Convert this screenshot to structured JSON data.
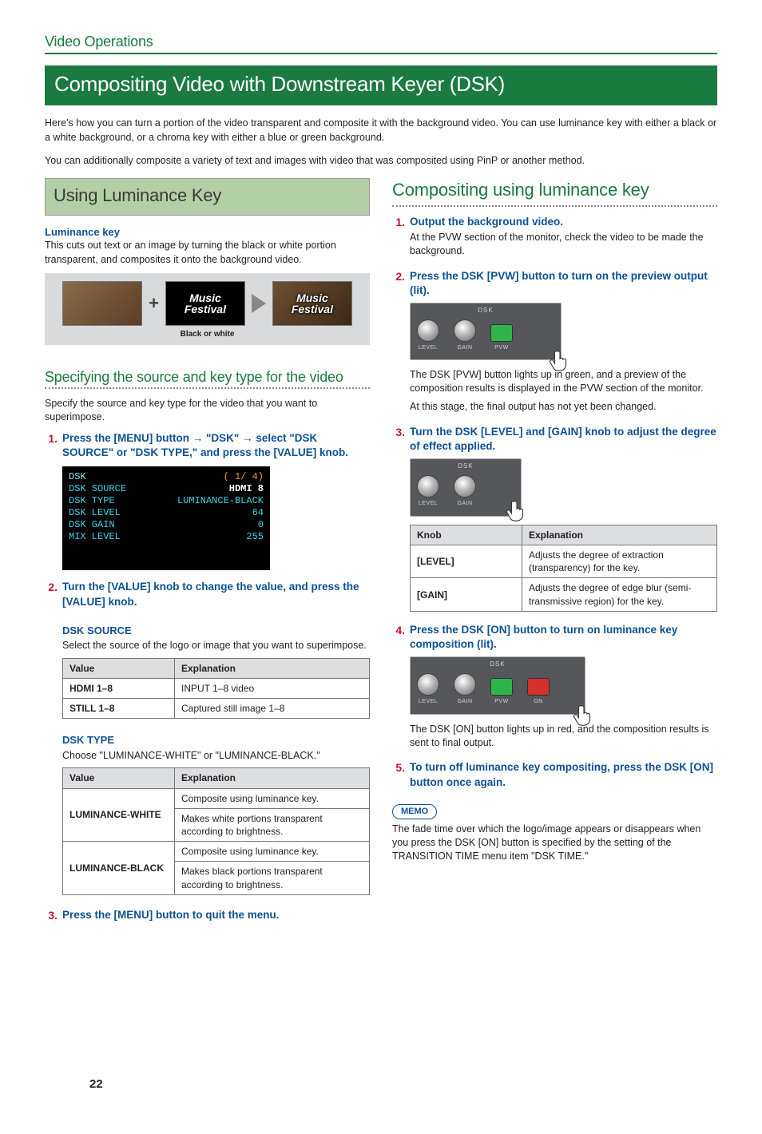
{
  "breadcrumb": "Video Operations",
  "h1": "Compositing Video with Downstream Keyer (DSK)",
  "intro1": "Here's how you can turn a portion of the video transparent and composite it with the background video. You can use luminance key with either a black or a white background, or a chroma key with either a blue or green background.",
  "intro2": "You can additionally composite a variety of text and images with video that was composited using PinP or another method.",
  "left": {
    "h2": "Using Luminance Key",
    "lk_head": "Luminance key",
    "lk_desc": "This cuts out text or an image by turning the black or white portion transparent, and composites it onto the background video.",
    "fig": {
      "mf1": "Music",
      "mf2": "Festival",
      "plus": "+",
      "cap": "Black or white"
    },
    "h3a": "Specifying the source and key type for the video",
    "h3a_desc": "Specify the source and key type for the video that you want to superimpose.",
    "step1": {
      "num": "1.",
      "title_a": "Press the [MENU] button ",
      "arrow": "→",
      "title_b": " \"DSK\" ",
      "title_c": " select \"DSK SOURCE\" or \"DSK TYPE,\" and press the [VALUE] knob."
    },
    "menu": {
      "title": "DSK",
      "page": "( 1/ 4)",
      "rows": [
        {
          "l": "DSK SOURCE",
          "r": "HDMI 8",
          "sel": true
        },
        {
          "l": "DSK TYPE",
          "r": "LUMINANCE-BLACK"
        },
        {
          "l": "DSK LEVEL",
          "r": "64"
        },
        {
          "l": "DSK GAIN",
          "r": "0"
        },
        {
          "l": "MIX LEVEL",
          "r": "255"
        }
      ]
    },
    "step2": {
      "num": "2.",
      "title": "Turn the [VALUE] knob to change the value, and press the [VALUE] knob."
    },
    "dsk_source": {
      "head": "DSK SOURCE",
      "desc": "Select the source of the logo or image that you want to superimpose.",
      "th1": "Value",
      "th2": "Explanation",
      "rows": [
        {
          "v": "HDMI 1–8",
          "e": "INPUT 1–8 video"
        },
        {
          "v": "STILL 1–8",
          "e": "Captured still image 1–8"
        }
      ]
    },
    "dsk_type": {
      "head": "DSK TYPE",
      "desc": "Choose \"LUMINANCE-WHITE\" or \"LUMINANCE-BLACK.\"",
      "th1": "Value",
      "th2": "Explanation",
      "rows": [
        {
          "v": "LUMINANCE-WHITE",
          "e1": "Composite using luminance key.",
          "e2": "Makes white portions transparent according to brightness."
        },
        {
          "v": "LUMINANCE-BLACK",
          "e1": "Composite using luminance key.",
          "e2": "Makes black portions transparent according to brightness."
        }
      ]
    },
    "step3": {
      "num": "3.",
      "title": "Press the [MENU] button to quit the menu."
    }
  },
  "right": {
    "h2": "Compositing using luminance key",
    "s1": {
      "num": "1.",
      "title": "Output the background video.",
      "text": "At the PVW section of the monitor, check the video to be made the background."
    },
    "s2": {
      "num": "2.",
      "title": "Press the DSK [PVW] button to turn on the preview output (lit).",
      "after1": "The DSK [PVW] button lights up in green, and a preview of the composition results is displayed in the PVW section of the monitor.",
      "after2": "At this stage, the final output has not yet been changed."
    },
    "s3": {
      "num": "3.",
      "title": "Turn the DSK [LEVEL] and [GAIN] knob to adjust the degree of effect applied."
    },
    "knob_table": {
      "th1": "Knob",
      "th2": "Explanation",
      "rows": [
        {
          "k": "[LEVEL]",
          "e": "Adjusts the degree of extraction (transparency) for the key."
        },
        {
          "k": "[GAIN]",
          "e": "Adjusts the degree of edge blur (semi-transmissive region) for the key."
        }
      ]
    },
    "s4": {
      "num": "4.",
      "title": "Press the DSK [ON] button to turn on luminance key composition (lit).",
      "after": "The DSK [ON] button lights up in red, and the composition results is sent to final output."
    },
    "s5": {
      "num": "5.",
      "title": "To turn off luminance key compositing, press the DSK [ON] button once again."
    },
    "memo_label": "MEMO",
    "memo_text": "The fade time over which the logo/image appears or disappears when you press the DSK [ON] button is specified by the setting of the TRANSITION TIME menu item \"DSK TIME.\"",
    "panel_label": "DSK",
    "klabels": {
      "level": "LEVEL",
      "gain": "GAIN",
      "pvw": "PVW",
      "on": "ON"
    }
  },
  "page_number": "22"
}
